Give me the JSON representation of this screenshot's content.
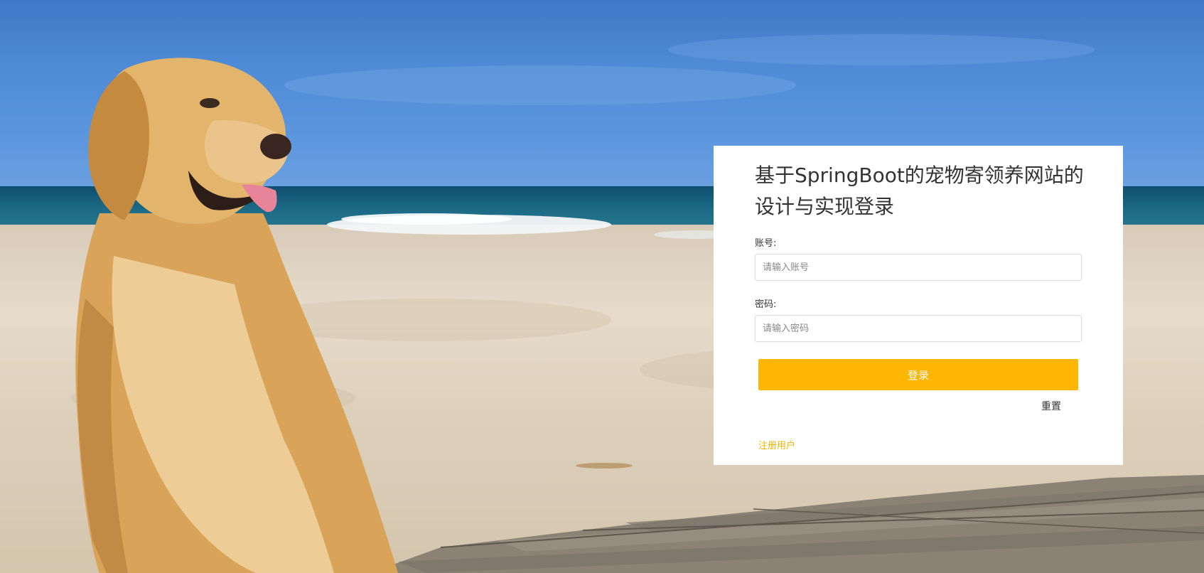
{
  "login": {
    "title": "基于SpringBoot的宠物寄领养网站的设计与实现登录",
    "account": {
      "label": "账号:",
      "placeholder": "请输入账号",
      "value": ""
    },
    "password": {
      "label": "密码:",
      "placeholder": "请输入密码",
      "value": ""
    },
    "login_button": "登录",
    "reset_link": "重置",
    "register_link": "注册用户"
  },
  "colors": {
    "accent": "#fdb703",
    "register_link": "#f0b400",
    "panel_bg": "#ffffff",
    "text": "#333333"
  },
  "background": {
    "icon": "golden-retriever-beach-photo"
  }
}
